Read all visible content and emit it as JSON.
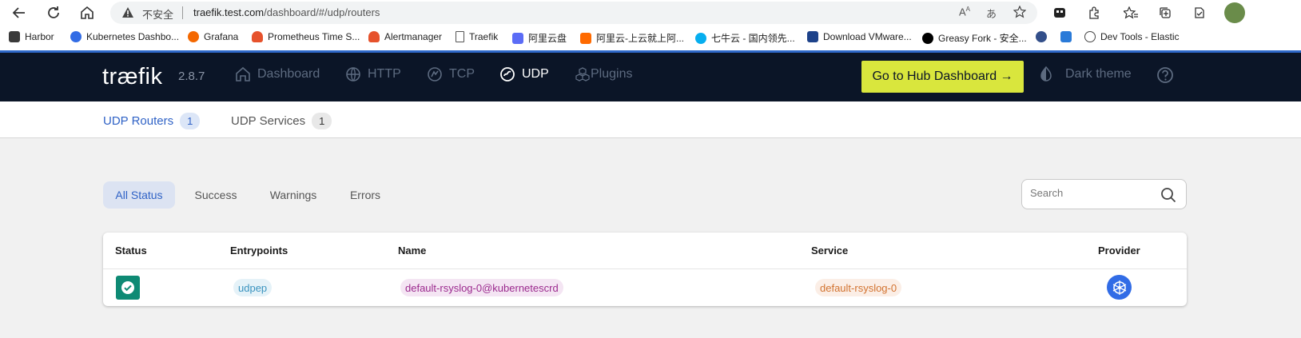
{
  "browser": {
    "insecure_label": "不安全",
    "url_domain": "traefik.test.com",
    "url_path": "/dashboard/#/udp/routers"
  },
  "bookmarks": [
    {
      "label": "Harbor",
      "color": "#3a3a3a"
    },
    {
      "label": "Kubernetes Dashbo...",
      "color": "#326ce5"
    },
    {
      "label": "Grafana",
      "color": "#f46800"
    },
    {
      "label": "Prometheus Time S...",
      "color": "#e6522c"
    },
    {
      "label": "Alertmanager",
      "color": "#e6522c"
    },
    {
      "label": "Traefik",
      "color": "#555555"
    },
    {
      "label": "阿里云盘",
      "color": "#5b6cf6"
    },
    {
      "label": "阿里云-上云就上阿...",
      "color": "#ff6a00"
    },
    {
      "label": "七牛云 - 国内领先...",
      "color": "#06aeef"
    },
    {
      "label": "Download VMware...",
      "color": "#1d428a"
    },
    {
      "label": "Greasy Fork - 安全...",
      "color": "#000000"
    },
    {
      "label": "",
      "color": "#334f8a"
    },
    {
      "label": "",
      "color": "#2a7ad8"
    },
    {
      "label": "Dev Tools - Elastic",
      "color": "#444444"
    }
  ],
  "app": {
    "logo": "træfik",
    "version": "2.8.7",
    "nav": {
      "dashboard": "Dashboard",
      "http": "HTTP",
      "tcp": "TCP",
      "udp": "UDP",
      "plugins": "Plugins"
    },
    "hub_button": "Go to Hub Dashboard →",
    "theme_toggle": "Dark theme",
    "colors": {
      "nav_bg": "#0b1527",
      "hub_accent": "#d9e63d",
      "primary": "#2f62c6"
    }
  },
  "subnav": {
    "routers_label": "UDP Routers",
    "routers_count": "1",
    "services_label": "UDP Services",
    "services_count": "1"
  },
  "filters": {
    "all": "All Status",
    "success": "Success",
    "warnings": "Warnings",
    "errors": "Errors",
    "selected": "All Status"
  },
  "search": {
    "placeholder": "Search",
    "value": ""
  },
  "table": {
    "headers": {
      "status": "Status",
      "entrypoints": "Entrypoints",
      "name": "Name",
      "service": "Service",
      "provider": "Provider"
    },
    "rows": [
      {
        "status": "success",
        "entrypoint": "udpep",
        "name": "default-rsyslog-0@kubernetescrd",
        "service": "default-rsyslog-0",
        "provider": "kubernetes-icon"
      }
    ]
  }
}
